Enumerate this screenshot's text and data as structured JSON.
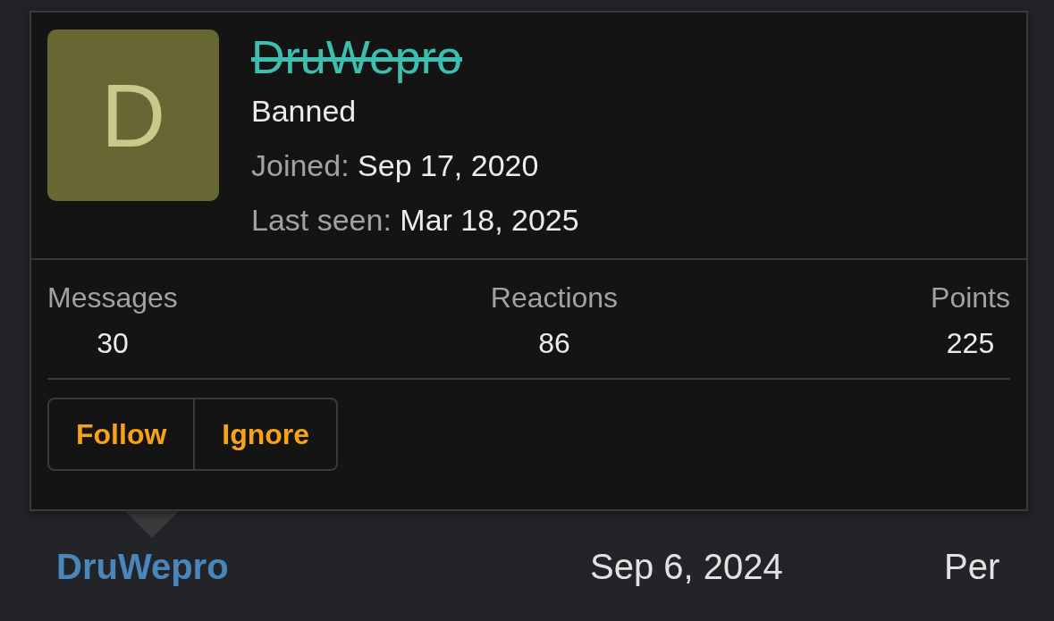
{
  "profile_popup": {
    "avatar_initial": "D",
    "username": "DruWepro",
    "banned": true,
    "user_title": "Banned",
    "joined_label": "Joined:",
    "joined": "Sep 17, 2020",
    "last_seen_label": "Last seen:",
    "last_seen": "Mar 18, 2025",
    "stats": [
      {
        "label": "Messages",
        "value": "30"
      },
      {
        "label": "Reactions",
        "value": "86"
      },
      {
        "label": "Points",
        "value": "225"
      }
    ],
    "buttons": [
      "Follow",
      "Ignore"
    ]
  },
  "member_row": {
    "name": "DruWepro",
    "date": "Sep 6, 2024",
    "column_3": "Per"
  }
}
